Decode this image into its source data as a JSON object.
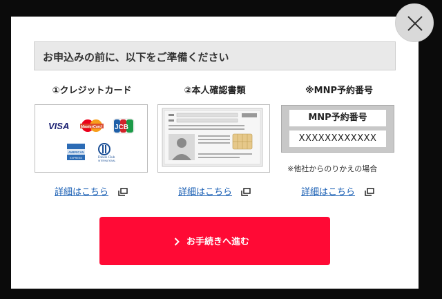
{
  "header": {
    "title": "お申込みの前に、以下をご準備ください"
  },
  "columns": [
    {
      "title": "①クレジットカード",
      "link": "詳細はこちら"
    },
    {
      "title": "②本人確認書類",
      "link": "詳細はこちら"
    },
    {
      "title": "※MNP予約番号",
      "link": "詳細はこちら"
    }
  ],
  "credit_cards": [
    "VISA",
    "MasterCard",
    "JCB",
    "AMERICAN EXPRESS",
    "Diners Club INTERNATIONAL"
  ],
  "mnp": {
    "label": "MNP予約番号",
    "value": "XXXXXXXXXXXX",
    "note": "※他社からのりかえの場合"
  },
  "proceed": {
    "label": "お手続きへ進む"
  },
  "icons": {
    "close": "close-icon",
    "external": "external-window-icon",
    "chevron": "chevron-right-icon"
  },
  "colors": {
    "accent": "#ff0a35",
    "link": "#1a5fb4"
  }
}
